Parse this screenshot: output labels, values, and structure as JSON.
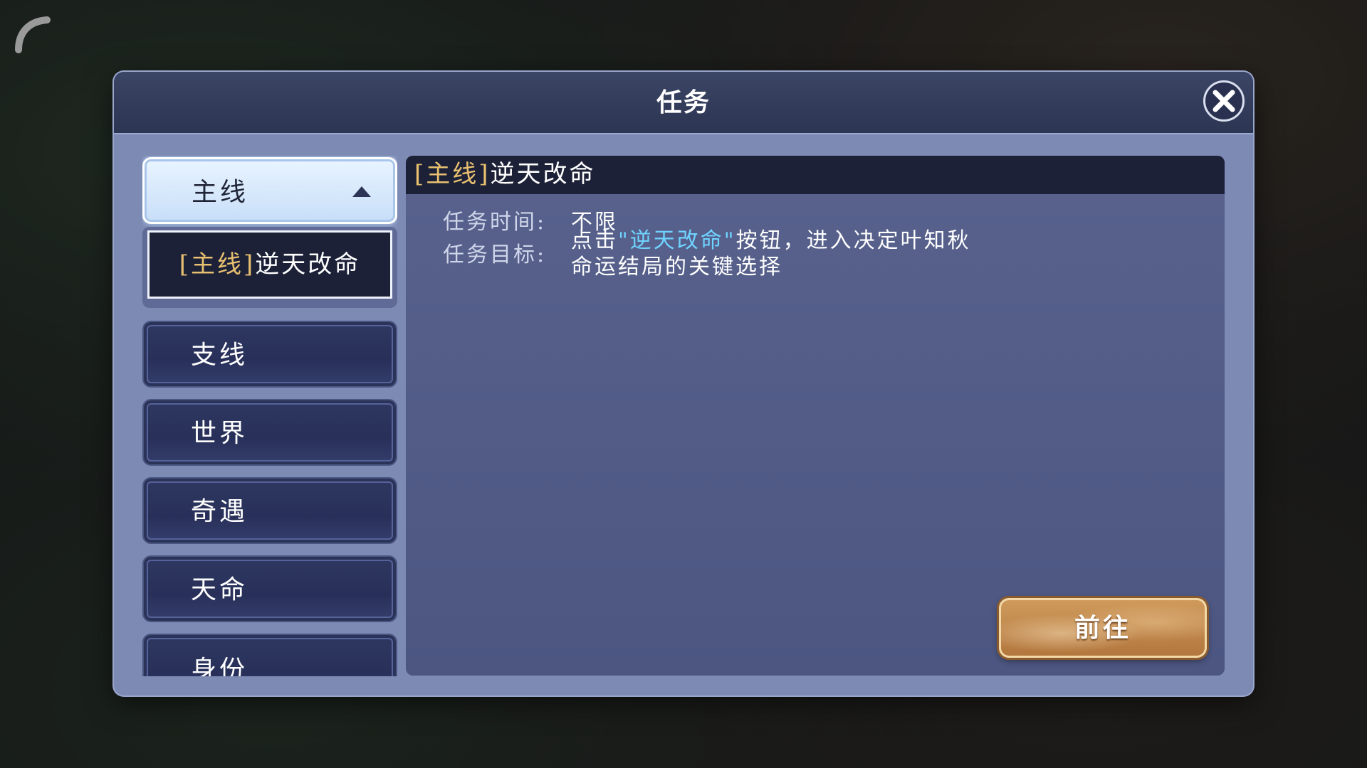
{
  "dialog": {
    "title": "任务",
    "close_icon": "close-icon"
  },
  "sidebar": {
    "active_category": {
      "label": "主线",
      "caret": "caret-up-icon"
    },
    "active_sub_item": {
      "prefix": "[主线]",
      "name": "逆天改命"
    },
    "categories": [
      {
        "label": "支线"
      },
      {
        "label": "世界"
      },
      {
        "label": "奇遇"
      },
      {
        "label": "天命"
      },
      {
        "label": "身份"
      }
    ]
  },
  "detail": {
    "title_prefix": "[主线]",
    "title_name": "逆天改命",
    "time_label": "任务时间:",
    "time_value": "不限",
    "goal_label": "任务目标:",
    "goal_part1": "点击",
    "goal_highlight": "\"逆天改命\"",
    "goal_part2": "按钮，进入决定叶知秋",
    "goal_line2": "命运结局的关键选择"
  },
  "actions": {
    "go_label": "前往"
  },
  "colors": {
    "highlight": "#6fd4ff",
    "gold": "#e8c070",
    "panel": "#7d8ab4"
  }
}
